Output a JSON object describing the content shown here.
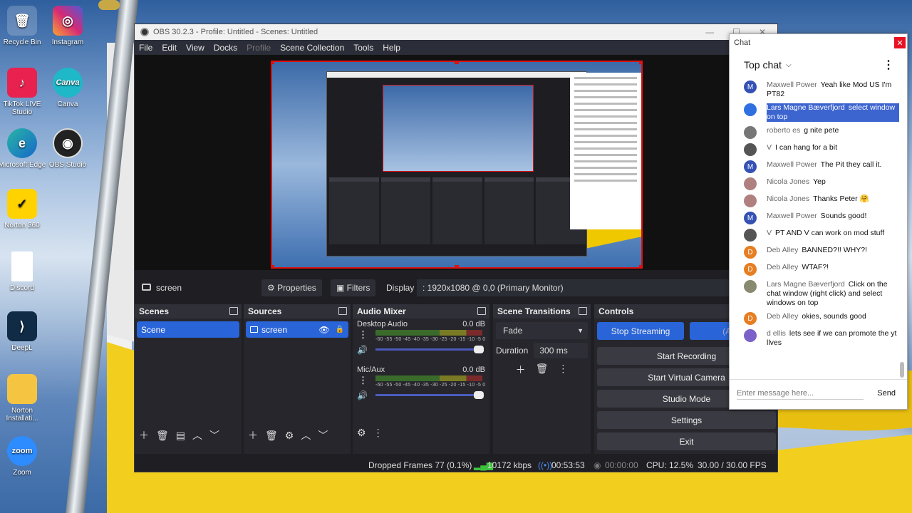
{
  "desktop": {
    "icons": [
      {
        "label": "Recycle Bin",
        "icon": "recycle-bin-icon"
      },
      {
        "label": "Instagram",
        "icon": "instagram-icon"
      },
      {
        "label": "TikTok LIVE Studio",
        "icon": "tiktok-icon"
      },
      {
        "label": "Canva",
        "icon": "canva-icon"
      },
      {
        "label": "Microsoft Edge",
        "icon": "edge-icon"
      },
      {
        "label": "OBS Studio",
        "icon": "obs-icon"
      },
      {
        "label": "Norton 360",
        "icon": "norton-icon"
      },
      {
        "label": "Discord",
        "icon": "file-icon"
      },
      {
        "label": "DeepL",
        "icon": "deepl-icon"
      },
      {
        "label": "Norton Installati...",
        "icon": "folder-icon"
      },
      {
        "label": "Zoom",
        "icon": "zoom-icon"
      }
    ]
  },
  "obs": {
    "title": "OBS 30.2.3 - Profile: Untitled - Scenes: Untitled",
    "menu": [
      "File",
      "Edit",
      "View",
      "Docks",
      "Profile",
      "Scene Collection",
      "Tools",
      "Help"
    ],
    "source_bar": {
      "source_name": "screen",
      "properties": "Properties",
      "filters": "Filters",
      "display_label": "Display",
      "display_value": ": 1920x1080 @ 0,0 (Primary Monitor)"
    },
    "scenes": {
      "title": "Scenes",
      "items": [
        "Scene"
      ]
    },
    "sources": {
      "title": "Sources",
      "items": [
        "screen"
      ]
    },
    "mixer": {
      "title": "Audio Mixer",
      "channels": [
        {
          "name": "Desktop Audio",
          "db": "0.0 dB",
          "level": 0.0
        },
        {
          "name": "Mic/Aux",
          "db": "0.0 dB",
          "level": 0.0
        }
      ],
      "scale": "-60 -55 -50 -45 -40 -35 -30 -25 -20 -15 -10 -5 0"
    },
    "transitions": {
      "title": "Scene Transitions",
      "type": "Fade",
      "duration_label": "Duration",
      "duration": "300 ms"
    },
    "controls": {
      "title": "Controls",
      "stop_streaming": "Stop Streaming",
      "auto": "(Auto",
      "start_recording": "Start Recording",
      "start_virtual_camera": "Start Virtual Camera",
      "studio_mode": "Studio Mode",
      "settings": "Settings",
      "exit": "Exit"
    },
    "status": {
      "dropped": "Dropped Frames 77 (0.1%)",
      "kbps": "10172 kbps",
      "stream_time": "00:53:53",
      "rec_time": "00:00:00",
      "cpu": "CPU: 12.5%",
      "fps": "30.00 / 30.00 FPS"
    },
    "colors": {
      "accent": "#2964d8",
      "selection_border": "#dd1111"
    }
  },
  "chat": {
    "window_title": "Chat",
    "header": "Top chat",
    "placeholder": "Enter message here...",
    "send": "Send",
    "messages": [
      {
        "author": "Maxwell Power",
        "text": "Yeah like Mod US I'm PT82",
        "avatar": "M",
        "color": "#3551b5"
      },
      {
        "author": "Lars Magne Bæverfjord",
        "text": "select window on top",
        "avatar": "",
        "color": "#2f6fe0"
      },
      {
        "author": "roberto es",
        "text": "g nite pete",
        "avatar": "",
        "color": "#777"
      },
      {
        "author": "V",
        "text": "I can hang for a bit",
        "avatar": "",
        "color": "#555"
      },
      {
        "author": "Maxwell Power",
        "text": "The Pit they call it.",
        "avatar": "M",
        "color": "#3551b5"
      },
      {
        "author": "Nicola Jones",
        "text": "Yep",
        "avatar": "",
        "color": "#b08080"
      },
      {
        "author": "Nicola Jones",
        "text": "Thanks Peter 🤗",
        "avatar": "",
        "color": "#b08080"
      },
      {
        "author": "Maxwell Power",
        "text": "Sounds good!",
        "avatar": "M",
        "color": "#3551b5"
      },
      {
        "author": "V",
        "text": "PT AND V can work on mod stuff",
        "avatar": "",
        "color": "#555"
      },
      {
        "author": "Deb Alley",
        "text": "BANNED?!! WHY?!",
        "avatar": "D",
        "color": "#e67e22"
      },
      {
        "author": "Deb Alley",
        "text": "WTAF?!",
        "avatar": "D",
        "color": "#e67e22"
      },
      {
        "author": "Lars Magne Bæverfjord",
        "text": "Click on the chat window (right click) and select windows on top",
        "avatar": "",
        "color": "#8a8a70"
      },
      {
        "author": "Deb Alley",
        "text": "okies, sounds good",
        "avatar": "D",
        "color": "#e67e22"
      },
      {
        "author": "d ellis",
        "text": "lets see if we can promote the yt llves",
        "avatar": "",
        "color": "#7b61c8"
      }
    ]
  }
}
